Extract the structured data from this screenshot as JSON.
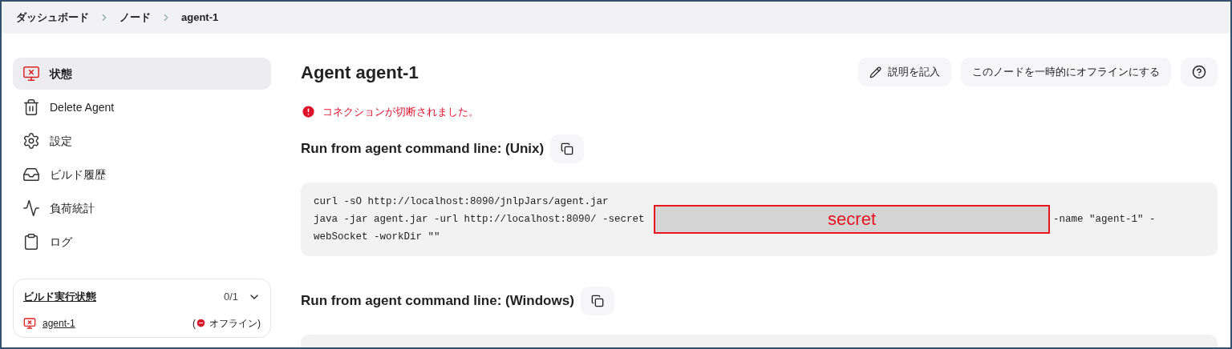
{
  "breadcrumb": [
    "ダッシュボード",
    "ノード",
    "agent-1"
  ],
  "sidebar": {
    "items": [
      {
        "label": "状態",
        "kind": "monitor-x",
        "selected": true
      },
      {
        "label": "Delete Agent",
        "kind": "trash",
        "selected": false
      },
      {
        "label": "設定",
        "kind": "gear",
        "selected": false
      },
      {
        "label": "ビルド履歴",
        "kind": "inbox",
        "selected": false
      },
      {
        "label": "負荷統計",
        "kind": "chart",
        "selected": false
      },
      {
        "label": "ログ",
        "kind": "clipboard",
        "selected": false
      }
    ],
    "executors": {
      "title": "ビルド実行状態",
      "count": "0/1",
      "expanded": true,
      "agent": "agent-1",
      "status_open": "(",
      "status": "オフライン)"
    }
  },
  "title": "Agent agent-1",
  "actions": [
    {
      "kind": "pencil",
      "label": "説明を記入"
    },
    {
      "kind": "text",
      "label": "このノードを一時的にオフラインにする"
    },
    {
      "kind": "help"
    }
  ],
  "error": "コネクションが切断されました。",
  "sections": [
    {
      "heading": "Run from agent command line: (Unix)",
      "lines": [
        "curl -sO http://localhost:8090/jnlpJars/agent.jar",
        "java -jar agent.jar -url http://localhost:8090/ -secret ",
        "-name \"agent-1\" -",
        "webSocket -workDir \"\""
      ],
      "redaction": "secret"
    },
    {
      "heading": "Run from agent command line: (Windows)"
    }
  ]
}
